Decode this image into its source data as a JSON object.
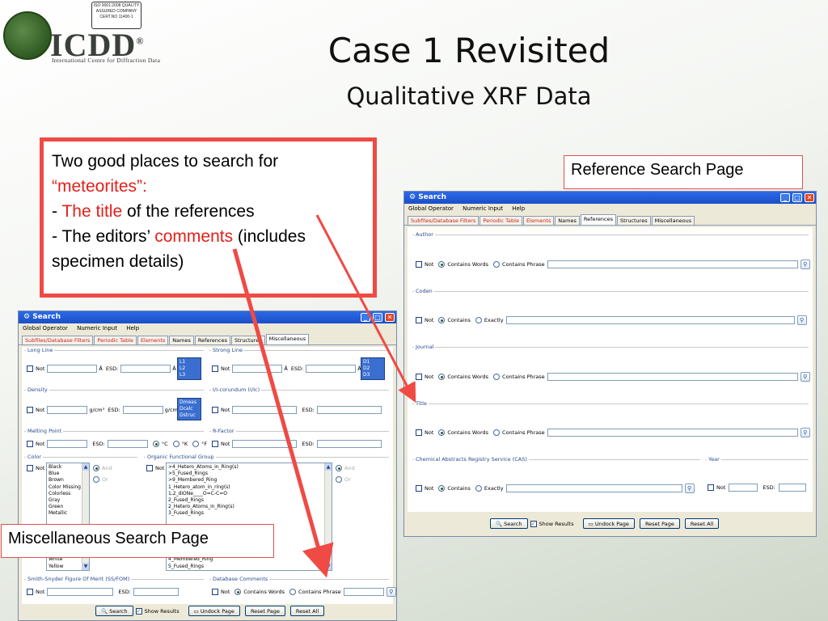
{
  "logo": {
    "iso_text": "ISO 9001:2008 QUALITY ASSURED COMPANY CERT.NO 11400-1",
    "name": "ICDD",
    "registered": "®",
    "subtitle": "International Centre for Diffraction Data"
  },
  "slide": {
    "title": "Case 1 Revisited",
    "subtitle": "Qualitative XRF Data"
  },
  "callout": {
    "line1": "Two good places to search for",
    "meteorites": "“meteorites”:",
    "dash1": "- ",
    "title_ref": "The title",
    "title_rest": " of the references",
    "dash2": "- The editors’ ",
    "comments": "comments",
    "comments_rest": " (includes specimen details)"
  },
  "labels": {
    "reference": "Reference Search Page",
    "misc": "Miscellaneous Search Page"
  },
  "colors": {
    "accent_red": "#f04a45",
    "xp_blue": "#2d6ae6"
  },
  "ref_window": {
    "title": "Search",
    "menu": [
      "Global Operator",
      "Numeric Input",
      "Help"
    ],
    "tabs": [
      "Subfiles/Database Filters",
      "Periodic Table",
      "Elements",
      "Names",
      "References",
      "Structures",
      "Miscellaneous"
    ],
    "groups": {
      "author": "Author",
      "coden": "Coden",
      "journal": "Journal",
      "title": "Title",
      "cas": "Chemical Abstracts Registry Service (CAS)",
      "year": "Year"
    },
    "not": "Not",
    "contains_words": "Contains Words",
    "contains_phrase": "Contains Phrase",
    "contains": "Contains",
    "exactly": "Exactly",
    "esd": "ESD:",
    "buttons": {
      "search": "Search",
      "show_results": "Show Results",
      "undock": "Undock Page",
      "reset_page": "Reset Page",
      "reset_all": "Reset All"
    }
  },
  "misc_window": {
    "title": "Search",
    "menu": [
      "Global Operator",
      "Numeric Input",
      "Help"
    ],
    "tabs": [
      "Subfiles/Database Filters",
      "Periodic Table",
      "Elements",
      "Names",
      "References",
      "Structures",
      "Miscellaneous"
    ],
    "long_line": "Long Line",
    "strong_line": "Strong Line",
    "density": "Density",
    "i_corundum": "I/I-corundum (I/Ic)",
    "melting_point": "Melting Point",
    "r_factor": "R-Factor",
    "color": "Color",
    "organic": "Organic Functional Group",
    "ss_fom": "Smith-Snyder Figure Of Merit (SS/FOM)",
    "db_comments": "Database Comments",
    "not": "Not",
    "esd": "ESD:",
    "angstrom": "Å",
    "gcm3": "g/cm³",
    "degC": "°C",
    "degK": "°K",
    "degF": "°F",
    "and": "And",
    "or": "Or",
    "contains_words": "Contains Words",
    "contains_phrase": "Contains Phrase",
    "line_list": [
      "L1",
      "L2",
      "L3"
    ],
    "strong_list": [
      "D1",
      "D2",
      "D3"
    ],
    "density_list": [
      "Dmeas",
      "Dcalc",
      "Dstruc"
    ],
    "colors": [
      "Black",
      "Blue",
      "Brown",
      "Color Missing",
      "Colorless",
      "Gray",
      "Green",
      "Metallic"
    ],
    "colors_tail": [
      "White",
      "Yellow"
    ],
    "groups_list": [
      ">4_Hetero_Atoms_in_Ring(s)",
      ">5_Fused_Rings",
      ">9_Membered_Ring",
      "1_Hetero_atom_in_ring(s)",
      "1,2_diONe____O=C-C=O",
      "2_Fused_Rings",
      "2_Hetero_Atoms_in_Ring(s)",
      "3_Fused_Rings"
    ],
    "groups_tail": [
      "4_Membered_Ring",
      "5_Fused_Rings"
    ],
    "buttons": {
      "search": "Search",
      "show_results": "Show Results",
      "undock": "Undock Page",
      "reset_page": "Reset Page",
      "reset_all": "Reset All"
    }
  }
}
